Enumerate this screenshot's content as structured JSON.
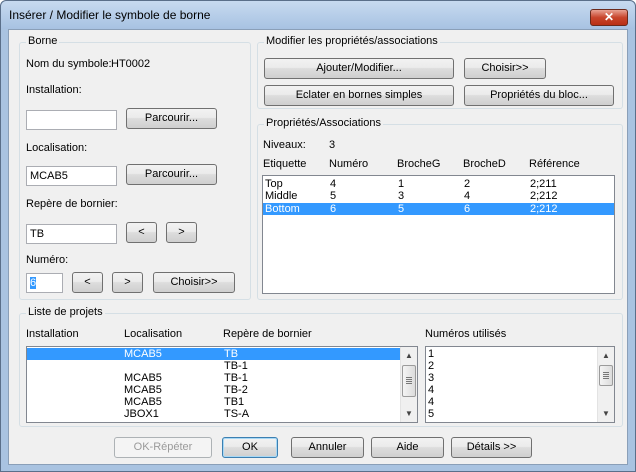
{
  "window": {
    "title": "Insérer / Modifier le symbole de borne",
    "close_label": "✕"
  },
  "borne": {
    "group_title": "Borne",
    "symbol_label": "Nom du symbole:",
    "symbol_name": "HT0002",
    "installation_label": "Installation:",
    "installation_value": "",
    "browse1_label": "Parcourir...",
    "localisation_label": "Localisation:",
    "localisation_value": "MCAB5",
    "browse2_label": "Parcourir...",
    "repere_label": "Repère de bornier:",
    "repere_value": "TB",
    "prev_label": "<",
    "next_label": ">",
    "numero_label": "Numéro:",
    "numero_value": "6",
    "num_prev_label": "<",
    "num_next_label": ">",
    "choose_label": "Choisir>>"
  },
  "modify": {
    "group_title": "Modifier les propriétés/associations",
    "add_modify_label": "Ajouter/Modifier...",
    "choose_label": "Choisir>>",
    "explode_label": "Eclater en bornes simples",
    "block_props_label": "Propriétés du bloc..."
  },
  "props": {
    "group_title": "Propriétés/Associations",
    "levels_label": "Niveaux:",
    "levels_value": "3",
    "columns": [
      "Etiquette",
      "Numéro",
      "BrocheG",
      "BrocheD",
      "Référence"
    ],
    "rows": [
      {
        "etiquette": "Top",
        "numero": "4",
        "brocheg": "1",
        "broched": "2",
        "reference": "2;211",
        "selected": false
      },
      {
        "etiquette": "Middle",
        "numero": "5",
        "brocheg": "3",
        "broched": "4",
        "reference": "2;212",
        "selected": false
      },
      {
        "etiquette": "Bottom",
        "numero": "6",
        "brocheg": "5",
        "broched": "6",
        "reference": "2;212",
        "selected": true
      }
    ]
  },
  "projects": {
    "group_title": "Liste de projets",
    "columns": [
      "Installation",
      "Localisation",
      "Repère de bornier"
    ],
    "used_label": "Numéros utilisés",
    "rows": [
      {
        "installation": "",
        "localisation": "MCAB5",
        "repere": "TB",
        "selected": true
      },
      {
        "installation": "",
        "localisation": "",
        "repere": "TB-1",
        "selected": false
      },
      {
        "installation": "",
        "localisation": "MCAB5",
        "repere": "TB-1",
        "selected": false
      },
      {
        "installation": "",
        "localisation": "MCAB5",
        "repere": "TB-2",
        "selected": false
      },
      {
        "installation": "",
        "localisation": "MCAB5",
        "repere": "TB1",
        "selected": false
      },
      {
        "installation": "",
        "localisation": "JBOX1",
        "repere": "TS-A",
        "selected": false
      }
    ],
    "used_numbers": [
      "1",
      "2",
      "3",
      "4",
      "4",
      "5"
    ]
  },
  "footer": {
    "ok_repeat_label": "OK-Répéter",
    "ok_label": "OK",
    "cancel_label": "Annuler",
    "help_label": "Aide",
    "details_label": "Détails >>"
  }
}
